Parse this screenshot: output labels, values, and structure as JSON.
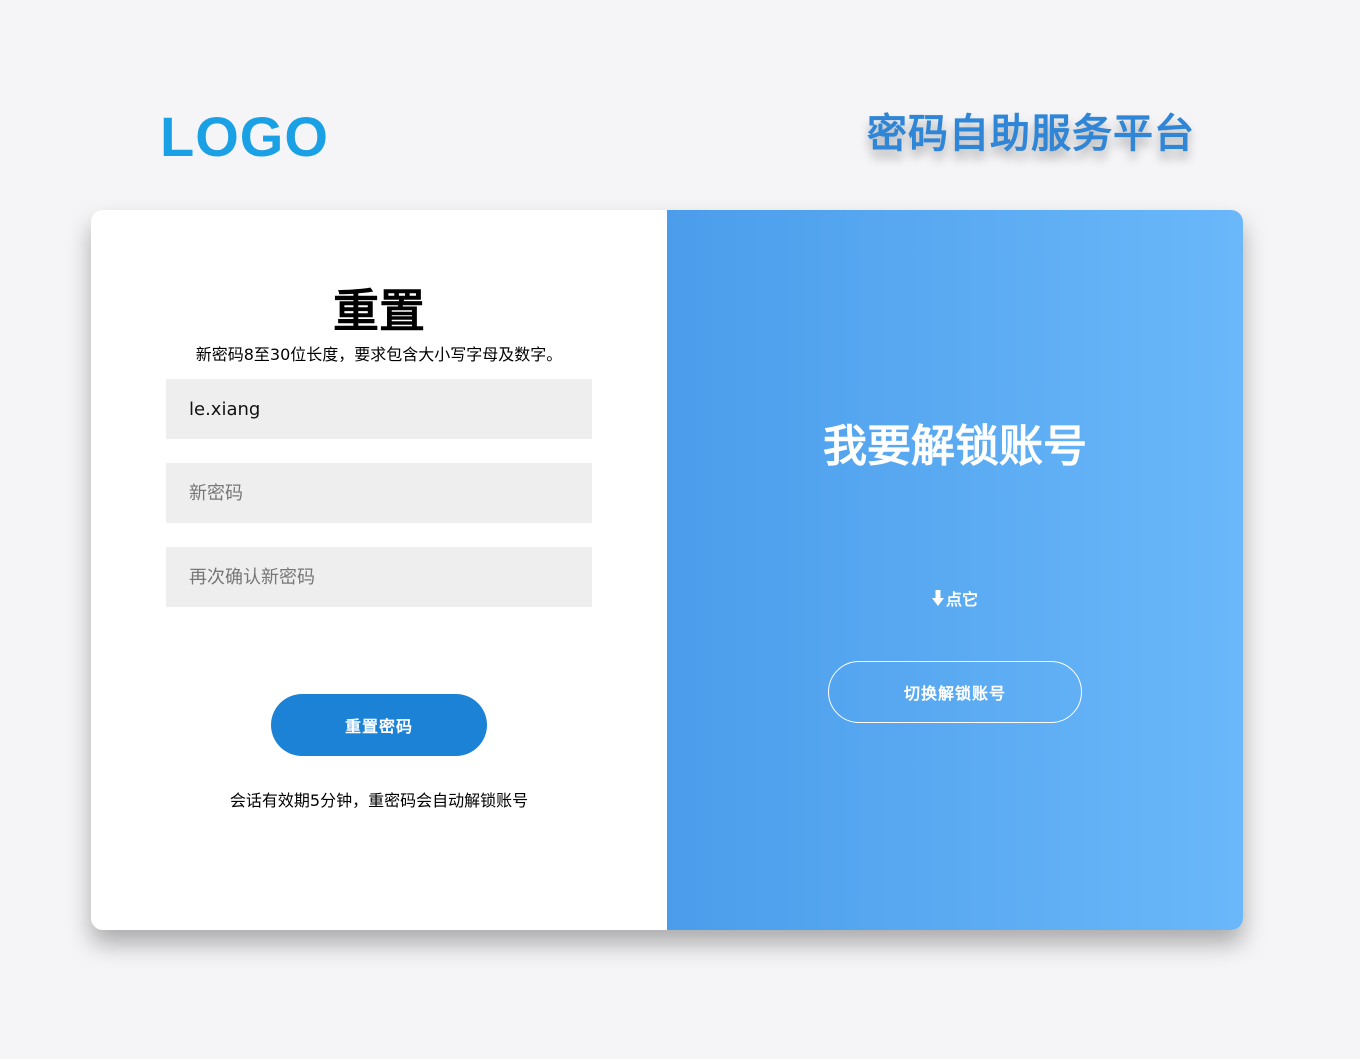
{
  "header": {
    "logo_text": "LOGO",
    "platform_title": "密码自助服务平台"
  },
  "reset_form": {
    "title": "重置",
    "hint": "新密码8至30位长度，要求包含大小写字母及数字。",
    "username_value": "le.xiang",
    "new_password_placeholder": "新密码",
    "confirm_password_placeholder": "再次确认新密码",
    "submit_label": "重置密码",
    "session_note": "会话有效期5分钟，重密码会自动解锁账号"
  },
  "unlock_panel": {
    "heading": "我要解锁账号",
    "click_hint": "点它",
    "switch_label": "切换解锁账号"
  },
  "icons": {
    "click_hint_icon": "arrow-down-icon"
  },
  "colors": {
    "logo": "#1aa0e4",
    "platform_title": "#2f86d6",
    "primary_button": "#1b82d6",
    "panel_gradient_start": "#4b9deb",
    "panel_gradient_end": "#6ab8fa",
    "input_background": "#eeeeee",
    "page_background": "#f5f5f7"
  }
}
